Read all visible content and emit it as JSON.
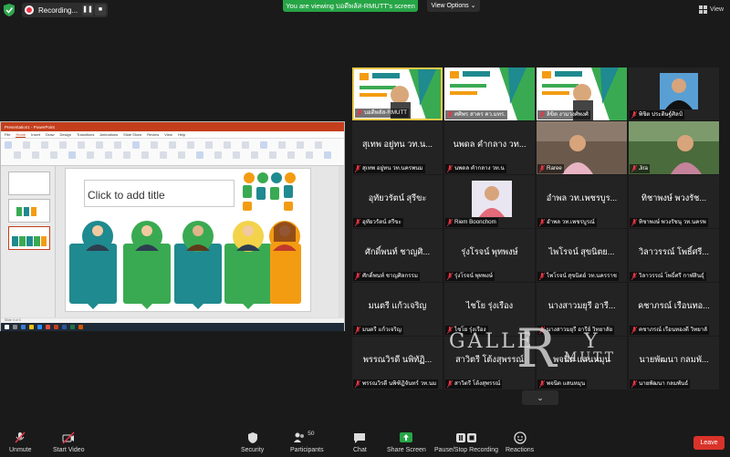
{
  "topbar": {
    "recording_label": "Recording...",
    "viewing_banner": "You are viewing บอดีพลัส-RMUTT's screen",
    "view_options": "View Options",
    "view_label": "View"
  },
  "ppt": {
    "window_title": "Presentation1 - PowerPoint",
    "tabs": [
      "File",
      "Home",
      "Insert",
      "Draw",
      "Design",
      "Transitions",
      "Animations",
      "Slide Show",
      "Review",
      "View",
      "Help"
    ],
    "placeholder_title": "Click to add title",
    "status_text": "Slide 3 of 3",
    "colors": {
      "teal": "#1f8a8f",
      "green": "#3aaa52",
      "orange": "#f39c12",
      "accent": "#c43e1c"
    }
  },
  "gallery": {
    "tiles": [
      {
        "name": "บอดีพลัส-RMUTT",
        "big": "",
        "type": "infographic",
        "speaking": true
      },
      {
        "name": "ศศิพร สาคร คว.มทร.",
        "big": "",
        "type": "infographic",
        "speaking": false
      },
      {
        "name": "ลิขิต งามวงศ์พงศ์",
        "big": "",
        "type": "infographic",
        "speaking": false
      },
      {
        "name": "พิชิต ประดิษฐ์ศิลป์",
        "big": "",
        "type": "person",
        "speaking": false
      },
      {
        "name": "สุเทพ อยู่ทน วท.นครพนม",
        "big": "สุเทพ อยู่ทน วท.น...",
        "type": "text",
        "speaking": false
      },
      {
        "name": "นพดล คำกลาง วท.น",
        "big": "นพดล คำกลาง วท...",
        "type": "text",
        "speaking": false
      },
      {
        "name": "Raree",
        "big": "",
        "type": "webcam",
        "speaking": false
      },
      {
        "name": "Jira",
        "big": "",
        "type": "webcam",
        "speaking": false
      },
      {
        "name": "อุทัยวรัตน์ สรีขะ",
        "big": "อุทัยวรัตน์ สุรีขะ",
        "type": "text",
        "speaking": false
      },
      {
        "name": "Riem Boonchom",
        "big": "",
        "type": "person",
        "speaking": false
      },
      {
        "name": "อำพล วท.เพชรบูรณ์",
        "big": "อำพล วท.เพชรบูร...",
        "type": "text",
        "speaking": false
      },
      {
        "name": "ทิชาพงษ์ พวงรัชนุ วท.นครพ",
        "big": "ทิชาพงษ์ พวงรัช...",
        "type": "text",
        "speaking": false
      },
      {
        "name": "ศักดิ์พนท์ ชาญศิลกรรม",
        "big": "ศักดิ์พนท์ ชาญศิ...",
        "type": "text",
        "speaking": false
      },
      {
        "name": "รุ่งโรจน์ พุทพงษ์",
        "big": "รุ่งโรจน์ พุทพงษ์",
        "type": "text",
        "speaking": false
      },
      {
        "name": "ไพโรจน์ สุขนิตย์ วท.นครราช",
        "big": "ไพโรจน์ สุขนิตย...",
        "type": "text",
        "speaking": false
      },
      {
        "name": "วิลาวรรณ์ โพธิ์ศรี กาฬสินธุ์",
        "big": "วิลาวรรณ์ โพธิ์ศรี...",
        "type": "text",
        "speaking": false
      },
      {
        "name": "มนตรี แก้วเจริญ",
        "big": "มนตรี แก้วเจริญ",
        "type": "text",
        "speaking": false
      },
      {
        "name": "ไชโย รุ่งเรือง",
        "big": "ไชโย รุ่งเรือง",
        "type": "text",
        "speaking": false
      },
      {
        "name": "นางสาวมยุรี อารีย์ วิทยาลัย",
        "big": "นางสาวมยุรี อารี...",
        "type": "text",
        "speaking": false
      },
      {
        "name": "คชาภรณ์ เรือนทองดี วิทยาลั",
        "big": "คชาภรณ์ เรือนทอ...",
        "type": "text",
        "speaking": false
      },
      {
        "name": "พรรณวิรดี นพิฑิฏิจันทร์ วท.นม",
        "big": "พรรณวิรดี นพิทัฏิ...",
        "type": "text",
        "speaking": false
      },
      {
        "name": "สาวิตรี โต้งสุพรรณ์",
        "big": "สาวิตรี โต้งสุพรรณ์",
        "type": "text",
        "speaking": false
      },
      {
        "name": "พจนิต แสนหมุน",
        "big": "พจนิต แสนหมุน",
        "type": "text",
        "speaking": false
      },
      {
        "name": "นายพัฒนา กลมพันธ์",
        "big": "นายพัฒนา กลมพั...",
        "type": "text",
        "speaking": false
      }
    ],
    "more_arrow": "⌄"
  },
  "watermark": {
    "gallery_text": "GALLE",
    "gallery_text2": "Y",
    "r_text": "R",
    "mutt_text": "MUTT"
  },
  "toolbar": {
    "unmute": "Unmute",
    "start_video": "Start Video",
    "security": "Security",
    "participants": "Participants",
    "participants_count": "50",
    "chat": "Chat",
    "share_screen": "Share Screen",
    "pause_recording": "Pause/Stop Recording",
    "reactions": "Reactions",
    "leave": "Leave"
  }
}
